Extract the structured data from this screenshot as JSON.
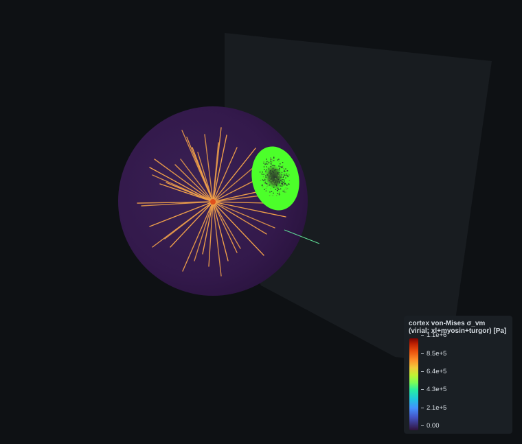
{
  "scene": {
    "background_color": "#0e1114",
    "plane_color": "#181c20",
    "sphere_color": "#341b4c",
    "fiber_color": "#f0a04a",
    "patch_color": "#4cff2a",
    "segment_color": "#5fdc96"
  },
  "colorbar": {
    "title": "cortex von-Mises σ_vm (virial: xl+myosin+turgor) [Pa]",
    "colormap": "turbo",
    "ticks": [
      {
        "label": "1.1e+6",
        "level": 1.0
      },
      {
        "label": "8.5e+5",
        "level": 0.8
      },
      {
        "label": "6.4e+5",
        "level": 0.6
      },
      {
        "label": "4.3e+5",
        "level": 0.4
      },
      {
        "label": "2.1e+5",
        "level": 0.2
      },
      {
        "label": "0.00",
        "level": 0.0
      }
    ]
  }
}
